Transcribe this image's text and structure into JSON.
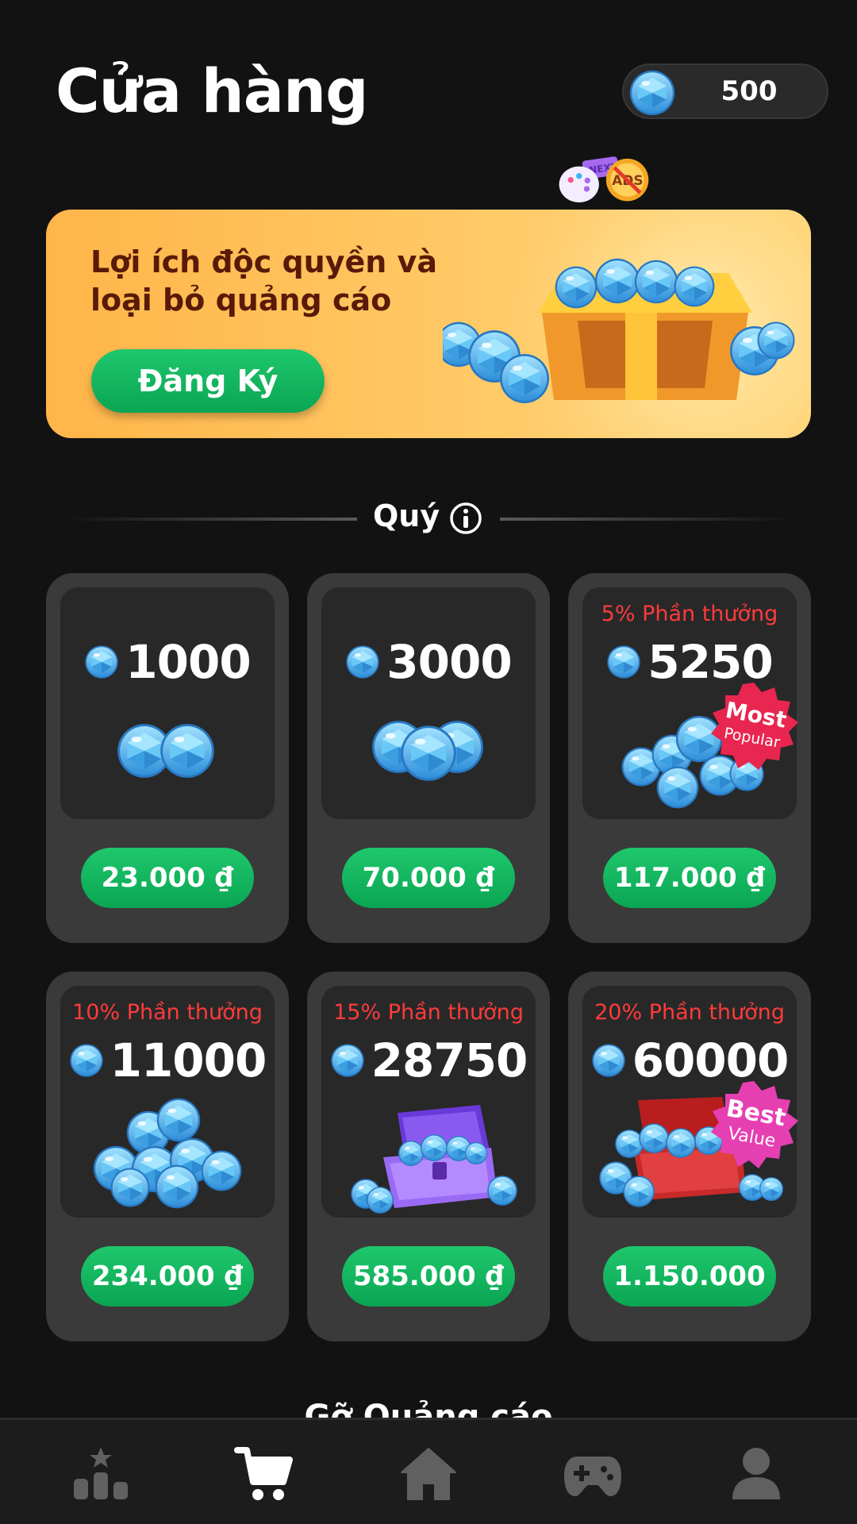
{
  "header": {
    "title": "Cửa hàng",
    "balance": "500",
    "balance_icon": "gem-icon"
  },
  "promo": {
    "text": "Lợi ích độc quyền và loại bỏ quảng cáo",
    "button_label": "Đăng Ký",
    "art_label_next": "NEXT",
    "art_label_ads": "ADS"
  },
  "section": {
    "title": "Quý",
    "info_icon": "info-icon"
  },
  "packs": [
    {
      "bonus": "",
      "amount": "1000",
      "price": "23.000 ₫"
    },
    {
      "bonus": "",
      "amount": "3000",
      "price": "70.000 ₫"
    },
    {
      "bonus": "5% Phần thưởng",
      "amount": "5250",
      "price": "117.000 ₫",
      "badge_top": "Most",
      "badge_bottom": "Popular"
    },
    {
      "bonus": "10% Phần thưởng",
      "amount": "11000",
      "price": "234.000 ₫"
    },
    {
      "bonus": "15% Phần thưởng",
      "amount": "28750",
      "price": "585.000 ₫"
    },
    {
      "bonus": "20% Phần thưởng",
      "amount": "60000",
      "price": "1.150.000",
      "badge_top": "Best",
      "badge_bottom": "Value"
    }
  ],
  "next_section_peek": "Gỡ Quảng cáo",
  "nav": {
    "items": [
      "leaderboard-icon",
      "cart-icon",
      "home-icon",
      "gamepad-icon",
      "profile-icon"
    ],
    "active": "cart-icon"
  },
  "colors": {
    "background": "#121212",
    "card": "#3a3a3a",
    "card_inner": "#282828",
    "accent_green": "#0fb25c",
    "bonus_red": "#ff3b3b",
    "promo_orange": "#ffbf5a",
    "gem_blue": "#4fb2ee"
  }
}
